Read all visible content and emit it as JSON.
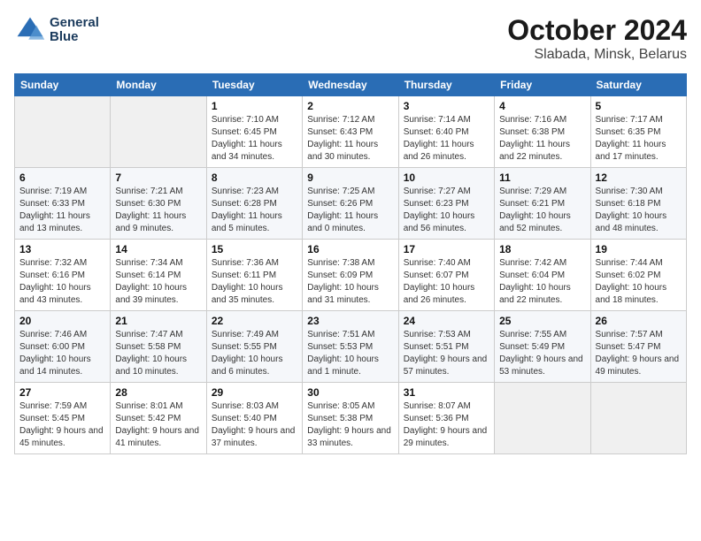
{
  "header": {
    "logo_line1": "General",
    "logo_line2": "Blue",
    "title": "October 2024",
    "subtitle": "Slabada, Minsk, Belarus"
  },
  "days_of_week": [
    "Sunday",
    "Monday",
    "Tuesday",
    "Wednesday",
    "Thursday",
    "Friday",
    "Saturday"
  ],
  "weeks": [
    [
      {
        "day": "",
        "info": ""
      },
      {
        "day": "",
        "info": ""
      },
      {
        "day": "1",
        "info": "Sunrise: 7:10 AM\nSunset: 6:45 PM\nDaylight: 11 hours and 34 minutes."
      },
      {
        "day": "2",
        "info": "Sunrise: 7:12 AM\nSunset: 6:43 PM\nDaylight: 11 hours and 30 minutes."
      },
      {
        "day": "3",
        "info": "Sunrise: 7:14 AM\nSunset: 6:40 PM\nDaylight: 11 hours and 26 minutes."
      },
      {
        "day": "4",
        "info": "Sunrise: 7:16 AM\nSunset: 6:38 PM\nDaylight: 11 hours and 22 minutes."
      },
      {
        "day": "5",
        "info": "Sunrise: 7:17 AM\nSunset: 6:35 PM\nDaylight: 11 hours and 17 minutes."
      }
    ],
    [
      {
        "day": "6",
        "info": "Sunrise: 7:19 AM\nSunset: 6:33 PM\nDaylight: 11 hours and 13 minutes."
      },
      {
        "day": "7",
        "info": "Sunrise: 7:21 AM\nSunset: 6:30 PM\nDaylight: 11 hours and 9 minutes."
      },
      {
        "day": "8",
        "info": "Sunrise: 7:23 AM\nSunset: 6:28 PM\nDaylight: 11 hours and 5 minutes."
      },
      {
        "day": "9",
        "info": "Sunrise: 7:25 AM\nSunset: 6:26 PM\nDaylight: 11 hours and 0 minutes."
      },
      {
        "day": "10",
        "info": "Sunrise: 7:27 AM\nSunset: 6:23 PM\nDaylight: 10 hours and 56 minutes."
      },
      {
        "day": "11",
        "info": "Sunrise: 7:29 AM\nSunset: 6:21 PM\nDaylight: 10 hours and 52 minutes."
      },
      {
        "day": "12",
        "info": "Sunrise: 7:30 AM\nSunset: 6:18 PM\nDaylight: 10 hours and 48 minutes."
      }
    ],
    [
      {
        "day": "13",
        "info": "Sunrise: 7:32 AM\nSunset: 6:16 PM\nDaylight: 10 hours and 43 minutes."
      },
      {
        "day": "14",
        "info": "Sunrise: 7:34 AM\nSunset: 6:14 PM\nDaylight: 10 hours and 39 minutes."
      },
      {
        "day": "15",
        "info": "Sunrise: 7:36 AM\nSunset: 6:11 PM\nDaylight: 10 hours and 35 minutes."
      },
      {
        "day": "16",
        "info": "Sunrise: 7:38 AM\nSunset: 6:09 PM\nDaylight: 10 hours and 31 minutes."
      },
      {
        "day": "17",
        "info": "Sunrise: 7:40 AM\nSunset: 6:07 PM\nDaylight: 10 hours and 26 minutes."
      },
      {
        "day": "18",
        "info": "Sunrise: 7:42 AM\nSunset: 6:04 PM\nDaylight: 10 hours and 22 minutes."
      },
      {
        "day": "19",
        "info": "Sunrise: 7:44 AM\nSunset: 6:02 PM\nDaylight: 10 hours and 18 minutes."
      }
    ],
    [
      {
        "day": "20",
        "info": "Sunrise: 7:46 AM\nSunset: 6:00 PM\nDaylight: 10 hours and 14 minutes."
      },
      {
        "day": "21",
        "info": "Sunrise: 7:47 AM\nSunset: 5:58 PM\nDaylight: 10 hours and 10 minutes."
      },
      {
        "day": "22",
        "info": "Sunrise: 7:49 AM\nSunset: 5:55 PM\nDaylight: 10 hours and 6 minutes."
      },
      {
        "day": "23",
        "info": "Sunrise: 7:51 AM\nSunset: 5:53 PM\nDaylight: 10 hours and 1 minute."
      },
      {
        "day": "24",
        "info": "Sunrise: 7:53 AM\nSunset: 5:51 PM\nDaylight: 9 hours and 57 minutes."
      },
      {
        "day": "25",
        "info": "Sunrise: 7:55 AM\nSunset: 5:49 PM\nDaylight: 9 hours and 53 minutes."
      },
      {
        "day": "26",
        "info": "Sunrise: 7:57 AM\nSunset: 5:47 PM\nDaylight: 9 hours and 49 minutes."
      }
    ],
    [
      {
        "day": "27",
        "info": "Sunrise: 7:59 AM\nSunset: 5:45 PM\nDaylight: 9 hours and 45 minutes."
      },
      {
        "day": "28",
        "info": "Sunrise: 8:01 AM\nSunset: 5:42 PM\nDaylight: 9 hours and 41 minutes."
      },
      {
        "day": "29",
        "info": "Sunrise: 8:03 AM\nSunset: 5:40 PM\nDaylight: 9 hours and 37 minutes."
      },
      {
        "day": "30",
        "info": "Sunrise: 8:05 AM\nSunset: 5:38 PM\nDaylight: 9 hours and 33 minutes."
      },
      {
        "day": "31",
        "info": "Sunrise: 8:07 AM\nSunset: 5:36 PM\nDaylight: 9 hours and 29 minutes."
      },
      {
        "day": "",
        "info": ""
      },
      {
        "day": "",
        "info": ""
      }
    ]
  ]
}
